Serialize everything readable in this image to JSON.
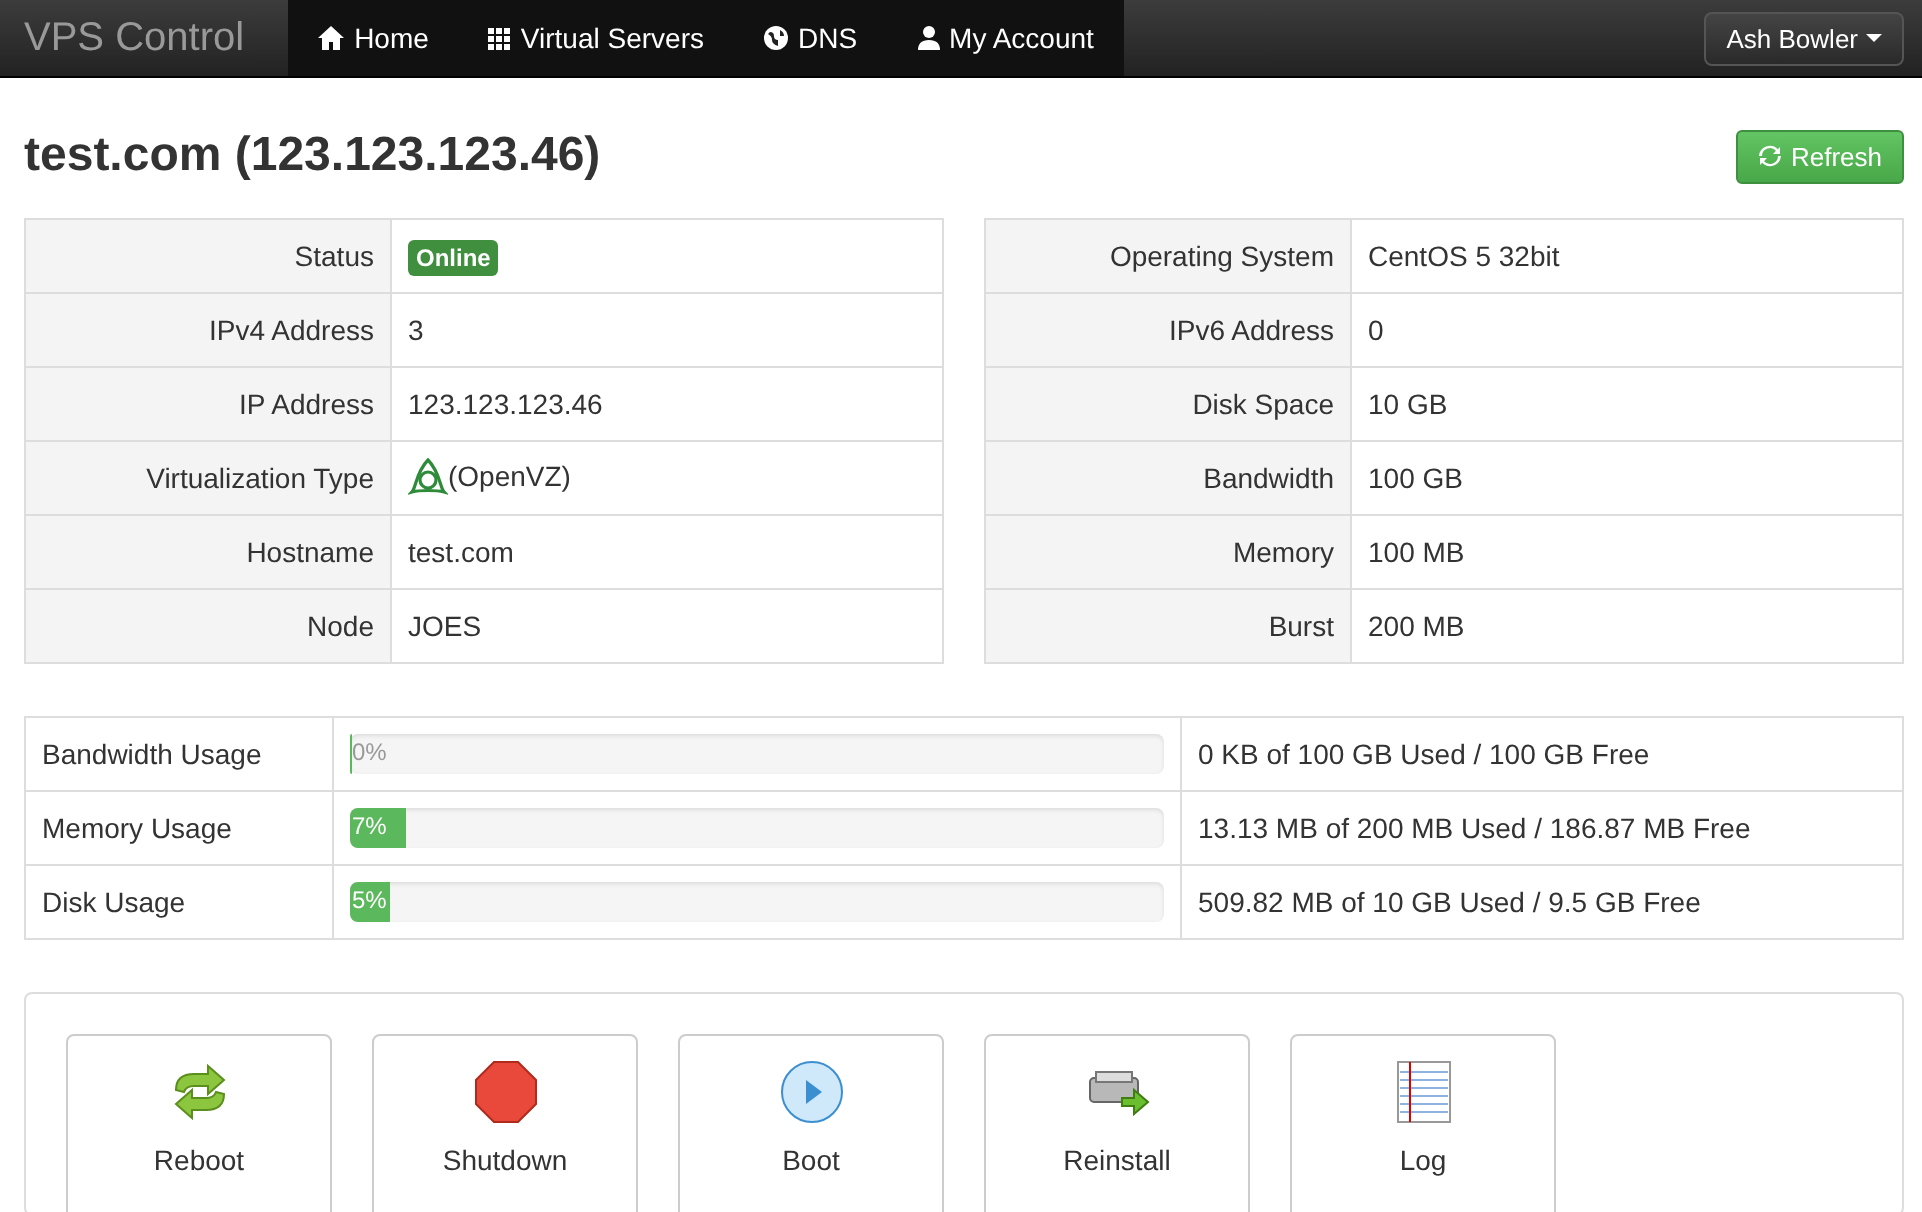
{
  "brand": "VPS Control",
  "nav": [
    {
      "label": "Home"
    },
    {
      "label": "Virtual Servers"
    },
    {
      "label": "DNS"
    },
    {
      "label": "My Account"
    }
  ],
  "user_menu": "Ash Bowler",
  "title": "test.com (123.123.123.46)",
  "refresh_button": "Refresh",
  "left_table": [
    {
      "label": "Status",
      "value": "Online",
      "kind": "badge"
    },
    {
      "label": "IPv4 Address",
      "value": "3",
      "kind": "text"
    },
    {
      "label": "IP Address",
      "value": "123.123.123.46",
      "kind": "text"
    },
    {
      "label": "Virtualization Type",
      "value": "(OpenVZ)",
      "kind": "logo"
    },
    {
      "label": "Hostname",
      "value": "test.com",
      "kind": "text"
    },
    {
      "label": "Node",
      "value": "JOES",
      "kind": "text"
    }
  ],
  "right_table": [
    {
      "label": "Operating System",
      "value": "CentOS 5 32bit"
    },
    {
      "label": "IPv6 Address",
      "value": "0"
    },
    {
      "label": "Disk Space",
      "value": "10 GB"
    },
    {
      "label": "Bandwidth",
      "value": "100 GB"
    },
    {
      "label": "Memory",
      "value": "100 MB"
    },
    {
      "label": "Burst",
      "value": "200 MB"
    }
  ],
  "usage": [
    {
      "label": "Bandwidth Usage",
      "level": 0,
      "percent": "0%",
      "detail": "0 KB of 100 GB Used / 100 GB Free"
    },
    {
      "label": "Memory Usage",
      "level": 0.07,
      "percent": "7%",
      "detail": "13.13 MB of 200 MB Used / 186.87 MB Free"
    },
    {
      "label": "Disk Usage",
      "level": 0.05,
      "percent": "5%",
      "detail": "509.82 MB of 10 GB Used / 9.5 GB Free"
    }
  ],
  "actions": [
    {
      "label": "Reboot"
    },
    {
      "label": "Shutdown"
    },
    {
      "label": "Boot"
    },
    {
      "label": "Reinstall"
    },
    {
      "label": "Log"
    }
  ]
}
